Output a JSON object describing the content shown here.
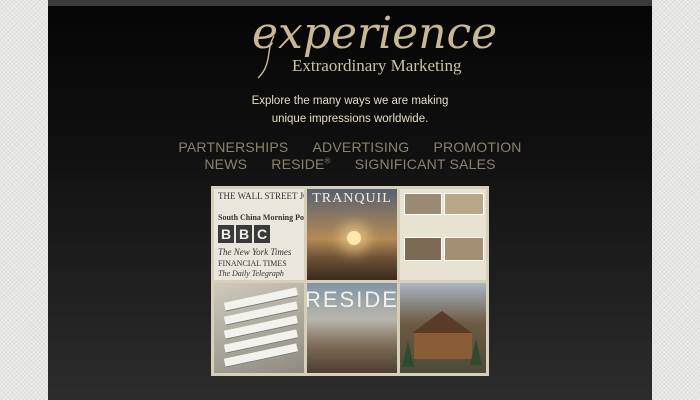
{
  "logo": {
    "word": "experience",
    "sub": "Extraordinary Marketing"
  },
  "tagline": {
    "line1": "Explore the many ways we are making",
    "line2": "unique impressions worldwide."
  },
  "nav": {
    "row1": [
      "PARTNERSHIPS",
      "ADVERTISING",
      "PROMOTION"
    ],
    "row2": [
      "NEWS",
      "RESIDE",
      "SIGNIFICANT SALES"
    ],
    "reside_mark": "®"
  },
  "collage": {
    "publications": [
      "THE WALL STREET JOURNAL",
      "South China Morning Post",
      "The New York Times",
      "FINANCIAL TIMES",
      "The Daily Telegraph"
    ],
    "bbc": [
      "B",
      "B",
      "C"
    ],
    "tile2_title": "TRANQUIL",
    "tile5_title": "RESIDE"
  },
  "colors": {
    "accent": "#c8b894",
    "nav": "#8c826c",
    "tagline": "#e6dcc4"
  }
}
